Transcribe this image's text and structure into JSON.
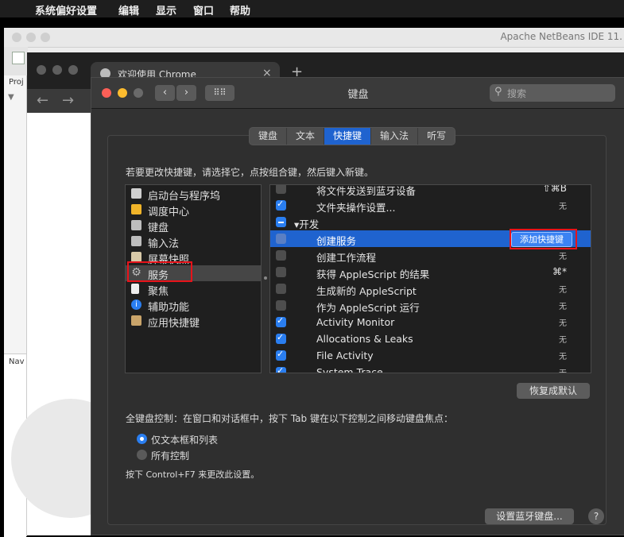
{
  "menubar": {
    "app": "系统偏好设置",
    "items": [
      "编辑",
      "显示",
      "窗口",
      "帮助"
    ]
  },
  "netbeans": {
    "title": "Apache NetBeans IDE 11.",
    "panel_top": "Proj",
    "panel_bottom": "Nav"
  },
  "chrome": {
    "tab_title": "欢迎使用 Chrome",
    "new_tab": "+",
    "close_tab": "×",
    "back": "←",
    "forward": "→"
  },
  "pref": {
    "title": "键盘",
    "search_placeholder": "搜索",
    "tabs": [
      "键盘",
      "文本",
      "快捷键",
      "输入法",
      "听写"
    ],
    "selected_tab": "快捷键",
    "instruction": "若要更改快捷键，请选择它，点按组合键，然后键入新键。",
    "categories": [
      {
        "label": "启动台与程序坞",
        "icon": "▭",
        "color": "#cfcfcf"
      },
      {
        "label": "调度中心",
        "icon": "▦",
        "color": "#f0b429"
      },
      {
        "label": "键盘",
        "icon": "▤",
        "color": "#bdbdbd"
      },
      {
        "label": "输入法",
        "icon": "▤",
        "color": "#bdbdbd"
      },
      {
        "label": "屏幕快照",
        "icon": "✂",
        "color": "#d8c9a8"
      },
      {
        "label": "服务",
        "icon": "⚙",
        "color": "#bbbbbb"
      },
      {
        "label": "聚焦",
        "icon": "▯",
        "color": "#eeeeee"
      },
      {
        "label": "辅助功能",
        "icon": "ⓘ",
        "color": "#2a7ef0"
      },
      {
        "label": "应用快捷键",
        "icon": "✎",
        "color": "#c9a46a"
      }
    ],
    "selected_category": "服务",
    "shortcuts": [
      {
        "name": "将文件发送到蓝牙设备",
        "state": "none",
        "key": "⇧⌘B"
      },
      {
        "name": "文件夹操作设置...",
        "state": "on",
        "key": "无"
      },
      {
        "name": "▾开发",
        "state": "mix",
        "key": ""
      },
      {
        "name": "创建服务",
        "state": "none",
        "key": ""
      },
      {
        "name": "创建工作流程",
        "state": "none",
        "key": "无"
      },
      {
        "name": "获得 AppleScript 的结果",
        "state": "none",
        "key": "⌘*"
      },
      {
        "name": "生成新的 AppleScript",
        "state": "none",
        "key": "无"
      },
      {
        "name": "作为 AppleScript 运行",
        "state": "none",
        "key": "无"
      },
      {
        "name": "Activity Monitor",
        "state": "on",
        "key": "无"
      },
      {
        "name": "Allocations & Leaks",
        "state": "on",
        "key": "无"
      },
      {
        "name": "File Activity",
        "state": "on",
        "key": "无"
      },
      {
        "name": "System Trace",
        "state": "on",
        "key": "无"
      }
    ],
    "selected_shortcut": "创建服务",
    "add_shortcut": "添加快捷键",
    "restore_defaults": "恢复成默认",
    "full_kb_label": "全键盘控制：在窗口和对话框中，按下 Tab 键在以下控制之间移动键盘焦点：",
    "radio_options": [
      "仅文本框和列表",
      "所有控制"
    ],
    "radio_selected": "仅文本框和列表",
    "hint": "按下 Control+F7 来更改此设置。",
    "bluetooth_button": "设置蓝牙键盘...",
    "help": "?"
  }
}
